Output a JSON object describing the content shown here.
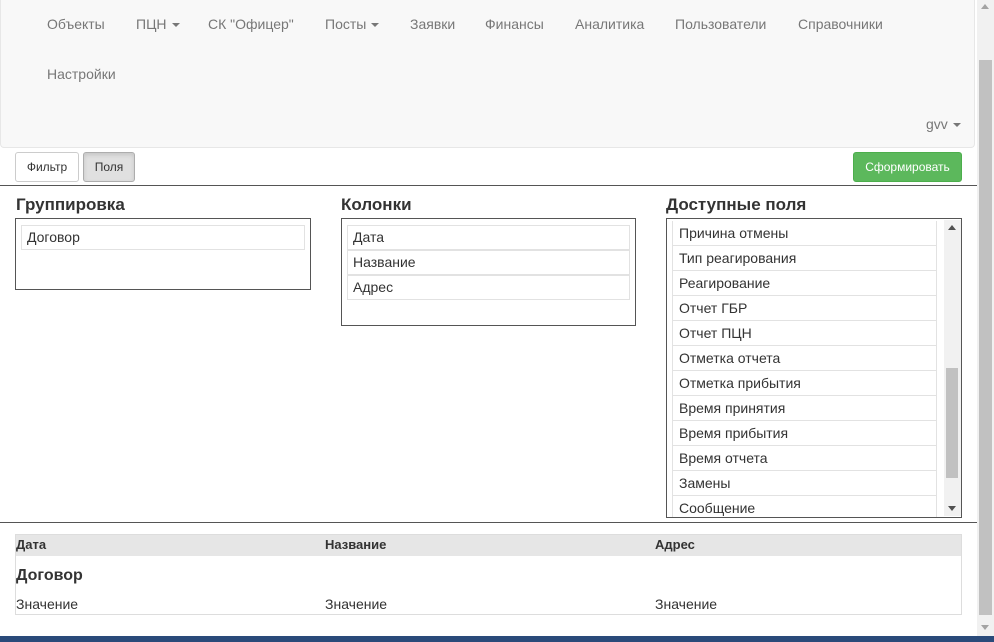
{
  "nav": {
    "items": [
      {
        "label": "Объекты",
        "dropdown": false
      },
      {
        "label": "ПЦН",
        "dropdown": true
      },
      {
        "label": "СК \"Офицер\"",
        "dropdown": false
      },
      {
        "label": "Посты",
        "dropdown": true
      },
      {
        "label": "Заявки",
        "dropdown": false
      },
      {
        "label": "Финансы",
        "dropdown": false
      },
      {
        "label": "Аналитика",
        "dropdown": false
      },
      {
        "label": "Пользователи",
        "dropdown": false
      },
      {
        "label": "Справочники",
        "dropdown": false
      },
      {
        "label": "Настройки",
        "dropdown": false
      }
    ],
    "user": "gvv"
  },
  "toolbar": {
    "filter_label": "Фильтр",
    "fields_label": "Поля",
    "generate_label": "Сформировать"
  },
  "grouping": {
    "title": "Группировка",
    "items": [
      "Договор"
    ]
  },
  "columns": {
    "title": "Колонки",
    "items": [
      "Дата",
      "Название",
      "Адрес"
    ]
  },
  "available": {
    "title": "Доступные поля",
    "items": [
      "Причина отмены",
      "Тип реагирования",
      "Реагирование",
      "Отчет ГБР",
      "Отчет ПЦН",
      "Отметка отчета",
      "Отметка прибытия",
      "Время принятия",
      "Время прибытия",
      "Время отчета",
      "Замены",
      "Сообщение"
    ]
  },
  "result": {
    "headers": [
      "Дата",
      "Название",
      "Адрес"
    ],
    "group": "Договор",
    "row": [
      "Значение",
      "Значение",
      "Значение"
    ]
  },
  "colors": {
    "accent_success": "#5cb85c",
    "navbar_bg": "#f8f8f8"
  }
}
